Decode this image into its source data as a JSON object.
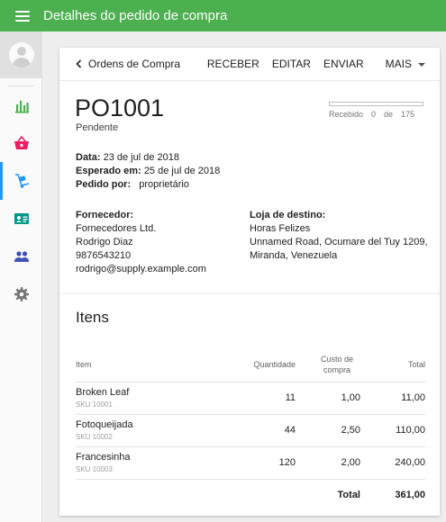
{
  "header": {
    "title": "Detalhes do pedido de compra"
  },
  "sidebar": {
    "items": [
      {
        "name": "reports",
        "icon": "bar-chart-icon",
        "color": "#4caf50"
      },
      {
        "name": "sales",
        "icon": "basket-icon",
        "color": "#e91e63"
      },
      {
        "name": "purchases",
        "icon": "dolly-icon",
        "color": "#2196f3",
        "active": true
      },
      {
        "name": "contacts",
        "icon": "contact-card-icon",
        "color": "#009688"
      },
      {
        "name": "users",
        "icon": "people-icon",
        "color": "#3f51b5"
      },
      {
        "name": "settings",
        "icon": "gear-icon",
        "color": "#757575"
      }
    ]
  },
  "toolbar": {
    "back_label": "Ordens de Compra",
    "receive_label": "RECEBER",
    "edit_label": "EDITAR",
    "send_label": "ENVIAR",
    "more_label": "MAIS"
  },
  "order": {
    "number": "PO1001",
    "status": "Pendente",
    "received_label": "Recebido",
    "received_count": "0",
    "received_of": "de",
    "total_qty": "175",
    "progress": 0,
    "date_label": "Data:",
    "date_value": "23 de jul de 2018",
    "expected_label": "Esperado em:",
    "expected_value": "25 de jul de 2018",
    "ordered_by_label": "Pedido por:",
    "ordered_by_value": "proprietário"
  },
  "supplier": {
    "label": "Fornecedor:",
    "name": "Fornecedores Ltd.",
    "contact": "Rodrigo Diaz",
    "phone": "9876543210",
    "email": "rodrigo@supply.example.com"
  },
  "destination": {
    "label": "Loja de destino:",
    "name": "Horas Felizes",
    "address1": "Unnamed Road, Ocumare del Tuy 1209,",
    "address2": "Miranda, Venezuela"
  },
  "items": {
    "title": "Itens",
    "headers": {
      "item": "Item",
      "qty": "Quantidade",
      "cost_line1": "Custo de",
      "cost_line2": "compra",
      "total": "Total"
    },
    "rows": [
      {
        "name": "Broken Leaf",
        "sku": "SKU 10001",
        "qty": "11",
        "cost": "1,00",
        "total": "11,00"
      },
      {
        "name": "Fotoqueijada",
        "sku": "SKU 10002",
        "qty": "44",
        "cost": "2,50",
        "total": "110,00"
      },
      {
        "name": "Francesinha",
        "sku": "SKU 10003",
        "qty": "120",
        "cost": "2,00",
        "total": "240,00"
      }
    ],
    "total_label": "Total",
    "total_value": "361,00"
  }
}
